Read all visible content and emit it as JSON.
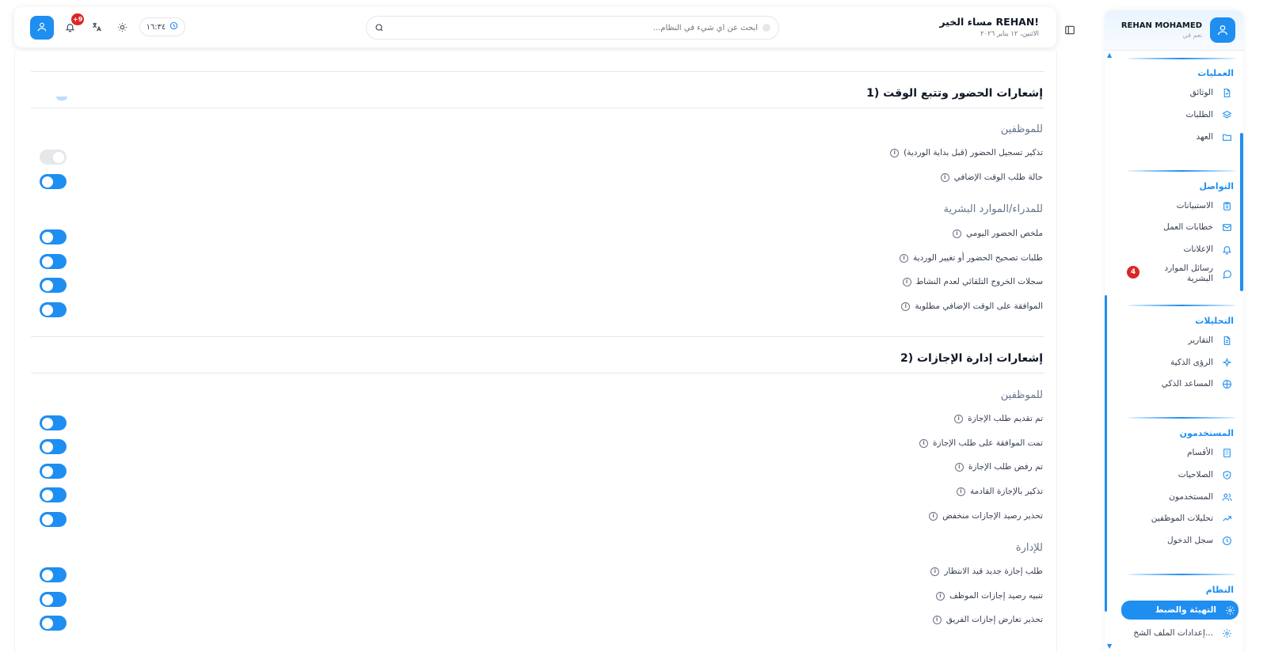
{
  "header": {
    "greeting": "مساء الخير REHAN!",
    "date": "الاثنين، ١٢ يناير ٢٠٢٦",
    "search_placeholder": "ابحث عن أي شيء في النظام...",
    "time": "١٦:٣٤",
    "notifications_badge": "+9"
  },
  "sidebar": {
    "user_name": "REHAN MOHAMED",
    "user_status": "نعم قي",
    "sections": [
      {
        "title": "العمليات",
        "items": [
          {
            "label": "الوثائق",
            "icon": "file-icon"
          },
          {
            "label": "الطلبات",
            "icon": "layers-icon"
          },
          {
            "label": "العهد",
            "icon": "folder-icon"
          }
        ]
      },
      {
        "title": "التواصل",
        "items": [
          {
            "label": "الاستبيانات",
            "icon": "clipboard-icon"
          },
          {
            "label": "خطابات العمل",
            "icon": "mail-icon"
          },
          {
            "label": "الإعلانات",
            "icon": "bell-icon"
          },
          {
            "label": "رسائل الموارد البشرية",
            "icon": "chat-icon",
            "badge": "4"
          }
        ]
      },
      {
        "title": "التحليلات",
        "items": [
          {
            "label": "التقارير",
            "icon": "report-icon"
          },
          {
            "label": "الرؤى الذكية",
            "icon": "sparkle-icon"
          },
          {
            "label": "المساعد الذكي",
            "icon": "brain-icon"
          }
        ]
      },
      {
        "title": "المستخدمون",
        "items": [
          {
            "label": "الأقسام",
            "icon": "building-icon"
          },
          {
            "label": "الصلاحيات",
            "icon": "shield-icon"
          },
          {
            "label": "المستخدمون",
            "icon": "users-icon"
          },
          {
            "label": "تحليلات الموظفين",
            "icon": "trend-icon"
          },
          {
            "label": "سجل الدخول",
            "icon": "clock-icon"
          }
        ]
      },
      {
        "title": "النظام",
        "items": [
          {
            "label": "التهيئة والضبط",
            "icon": "gear-icon",
            "active": true
          },
          {
            "label": "إعدادات الملف الشخ...",
            "icon": "gear-icon"
          }
        ]
      }
    ]
  },
  "content": {
    "attendance": {
      "title": "1) إشعارات الحضور وتتبع الوقت",
      "employees_title": "للموظفين",
      "employees": [
        {
          "label": "تذكير تسجيل الحضور (قبل بداية الوردية)",
          "on": false
        },
        {
          "label": "حالة طلب الوقت الإضافي",
          "on": true
        }
      ],
      "managers_title": "للمدراء/الموارد البشرية",
      "managers": [
        {
          "label": "ملخص الحضور اليومي",
          "on": true
        },
        {
          "label": "طلبات تصحيح الحضور أو تغيير الوردية",
          "on": true
        },
        {
          "label": "سجلات الخروج التلقائي لعدم النشاط",
          "on": true
        },
        {
          "label": "الموافقة على الوقت الإضافي مطلوبة",
          "on": true
        }
      ]
    },
    "leave": {
      "title": "2) إشعارات إدارة الإجازات",
      "employees_title": "للموظفين",
      "employees": [
        {
          "label": "تم تقديم طلب الإجازة",
          "on": true
        },
        {
          "label": "تمت الموافقة على طلب الإجازة",
          "on": true
        },
        {
          "label": "تم رفض طلب الإجازة",
          "on": true
        },
        {
          "label": "تذكير بالإجازة القادمة",
          "on": true
        },
        {
          "label": "تحذير رصيد الإجازات منخفض",
          "on": true
        }
      ],
      "admin_title": "للإدارة",
      "admin": [
        {
          "label": "طلب إجازة جديد قيد الانتظار",
          "on": true
        },
        {
          "label": "تنبيه رصيد إجازات الموظف",
          "on": true
        },
        {
          "label": "تحذير تعارض إجازات الفريق",
          "on": true
        }
      ]
    }
  },
  "colors": {
    "accent": "#1f8ef1",
    "badge": "#dc2626",
    "toggle_off": "#e5e7eb"
  }
}
